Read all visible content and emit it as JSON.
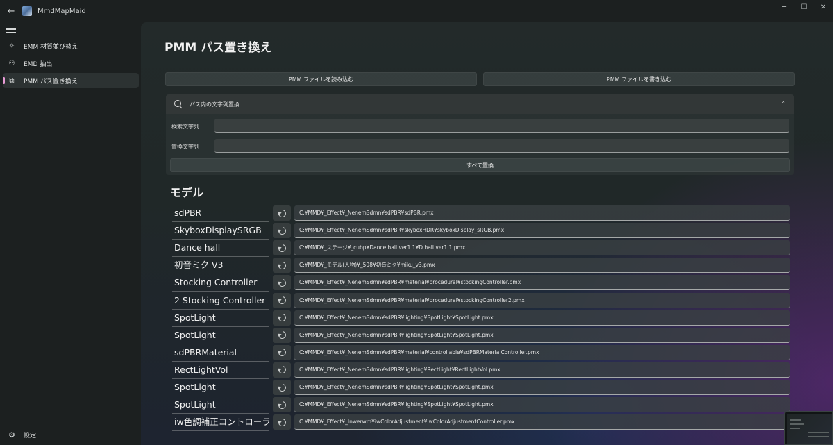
{
  "window": {
    "title": "MmdMapMaid",
    "back_icon": "back-arrow-icon",
    "controls": {
      "minimize": "─",
      "maximize": "☐",
      "close": "✕"
    }
  },
  "sidebar": {
    "items": [
      {
        "label": "EMM 材質並び替え",
        "icon": "sparkle-sort-icon",
        "glyph": "✧"
      },
      {
        "label": "EMD 抽出",
        "icon": "people-extract-icon",
        "glyph": "⚇"
      },
      {
        "label": "PMM パス置き換え",
        "icon": "swap-window-icon",
        "glyph": "⧉",
        "active": true
      }
    ],
    "settings_label": "設定",
    "settings_glyph": "⚙"
  },
  "main": {
    "title": "PMM パス置き換え",
    "read_button": "PMM ファイルを読み込む",
    "write_button": "PMM ファイルを書き込む",
    "replace_panel": {
      "title": "パス内の文字列置換",
      "chevron": "⌃",
      "search_label": "検索文字列",
      "search_value": "",
      "replace_label": "置換文字列",
      "replace_value": "",
      "replace_all_button": "すべて置換"
    },
    "section_title": "モデル",
    "models": [
      {
        "name": "sdPBR",
        "path": "C:¥MMD¥_Effect¥_NenemSdmn¥sdPBR¥sdPBR.pmx"
      },
      {
        "name": "SkyboxDisplaySRGB",
        "path": "C:¥MMD¥_Effect¥_NenemSdmn¥sdPBR¥skyboxHDR¥skyboxDisplay_sRGB.pmx"
      },
      {
        "name": "Dance hall",
        "path": "C:¥MMD¥_ステージ¥_cubp¥Dance hall ver1.1¥D hall ver1.1.pmx"
      },
      {
        "name": "初音ミク V3",
        "path": "C:¥MMD¥_モデル(人物)¥_508¥初音ミク¥miku_v3.pmx"
      },
      {
        "name": "Stocking Controller",
        "path": "C:¥MMD¥_Effect¥_NenemSdmn¥sdPBR¥material¥procedural¥stockingController.pmx"
      },
      {
        "name": "2 Stocking Controller",
        "path": "C:¥MMD¥_Effect¥_NenemSdmn¥sdPBR¥material¥procedural¥stockingController2.pmx"
      },
      {
        "name": "SpotLight",
        "path": "C:¥MMD¥_Effect¥_NenemSdmn¥sdPBR¥lighting¥SpotLight¥SpotLight.pmx"
      },
      {
        "name": "SpotLight",
        "path": "C:¥MMD¥_Effect¥_NenemSdmn¥sdPBR¥lighting¥SpotLight¥SpotLight.pmx"
      },
      {
        "name": "sdPBRMaterial",
        "path": "C:¥MMD¥_Effect¥_NenemSdmn¥sdPBR¥material¥controllable¥sdPBRMaterialController.pmx"
      },
      {
        "name": "RectLightVol",
        "path": "C:¥MMD¥_Effect¥_NenemSdmn¥sdPBR¥lighting¥RectLight¥RectLightVol.pmx"
      },
      {
        "name": "SpotLight",
        "path": "C:¥MMD¥_Effect¥_NenemSdmn¥sdPBR¥lighting¥SpotLight¥SpotLight.pmx"
      },
      {
        "name": "SpotLight",
        "path": "C:¥MMD¥_Effect¥_NenemSdmn¥sdPBR¥lighting¥SpotLight¥SpotLight.pmx"
      },
      {
        "name": "iw色調補正コントローラー",
        "path": "C:¥MMD¥_Effect¥_Inwerwm¥iwColorAdjustment¥iwColorAdjustmentController.pmx"
      }
    ],
    "reset_icon": "reset-rotate-icon"
  },
  "colors": {
    "accent": "#e89cd6",
    "background": "#1c2020"
  }
}
